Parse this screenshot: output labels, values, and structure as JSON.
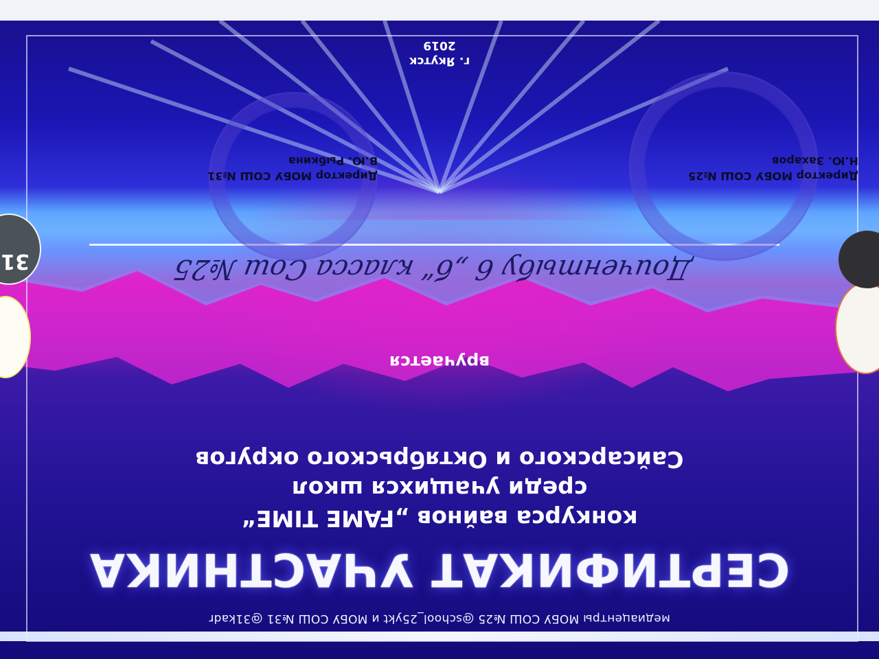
{
  "certificate": {
    "footer_media": "медиацентры МОБУ СОШ №25 @school_25ykt и МОБУ СОШ №31 @31kadr",
    "title": "СЕРТИФИКАТ УЧАСТНИКА",
    "subtitle_line1": "конкурса вайнов „FAME TIME“",
    "subtitle_line2": "среди учащихся школ",
    "subtitle_line3": "Сайсарского и Октябрьского округов",
    "award_label": "вручается",
    "recipient_handwritten": "Доичентыбу 6 „б“ класса Сош №25",
    "signature_left_title": "Директор МОБУ СОШ №25",
    "signature_left_name": "Н.Ю. Захаров",
    "signature_right_title": "Директор МОБУ СОШ №31",
    "signature_right_name": "В.Ю. Рыбкина",
    "city": "г. Якутск",
    "year": "2019",
    "side_logo_text": "31-"
  },
  "colors": {
    "deep_blue": "#1a0f8f",
    "magenta": "#d416a8",
    "light_blue": "#78b8ff",
    "text_white": "#ffffff",
    "handwriting": "#1c1a63"
  },
  "decor": {
    "stamps": [
      "seal-left",
      "seal-right"
    ],
    "icons": [
      "school-logo-left",
      "school-logo-right"
    ]
  }
}
